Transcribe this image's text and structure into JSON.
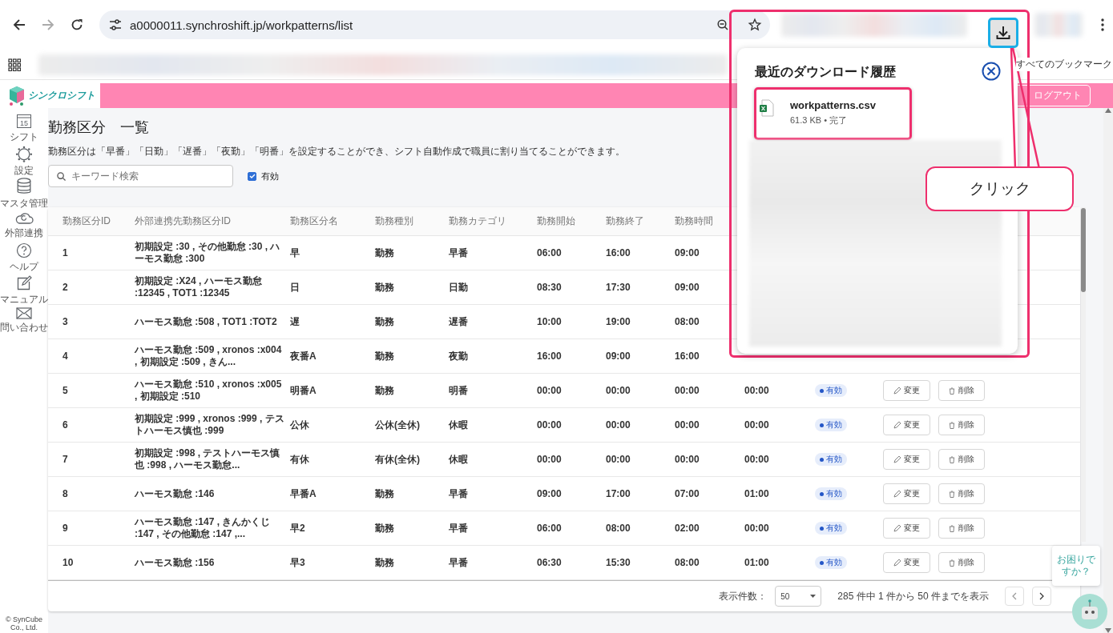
{
  "browser": {
    "url": "a0000011.synchroshift.jp/workpatterns/list",
    "bookmarks_all": "すべてのブックマーク"
  },
  "app": {
    "logo": "シンクロシフト",
    "logout": "ログアウト"
  },
  "sidebar": {
    "items": [
      {
        "kind": "calendar",
        "label": "シフト",
        "icon_text": "15"
      },
      {
        "kind": "gear",
        "label": "設定"
      },
      {
        "kind": "database",
        "label": "マスタ管理"
      },
      {
        "kind": "cloud",
        "label": "外部連携"
      },
      {
        "kind": "help",
        "label": "ヘルプ"
      },
      {
        "kind": "edit",
        "label": "マニュアル"
      },
      {
        "kind": "mail",
        "label": "問い合わせ"
      }
    ],
    "copyright": "© SynCube\nCo., Ltd."
  },
  "page": {
    "title": "勤務区分　一覧",
    "description": "勤務区分は「早番」「日勤」「遅番」「夜勤」「明番」を設定することができ、シフト自動作成で職員に割り当てることができます。"
  },
  "filter": {
    "search_placeholder": "キーワード検索",
    "active_label": "有効",
    "active_checked": true
  },
  "table": {
    "columns": [
      "勤務区分ID",
      "外部連携先勤務区分ID",
      "勤務区分名",
      "勤務種別",
      "勤務カテゴリ",
      "勤務開始",
      "勤務終了",
      "勤務時間"
    ],
    "rows": [
      {
        "id": "1",
        "external_id": "初期設定 :30 , その他勤怠 :30 , ハーモス勤怠 :300",
        "name": "早",
        "type": "勤務",
        "category": "早番",
        "start": "06:00",
        "end": "16:00",
        "hours": "09:00"
      },
      {
        "id": "2",
        "external_id": "初期設定 :X24 , ハーモス勤怠 :12345 , TOT1 :12345",
        "name": "日",
        "type": "勤務",
        "category": "日勤",
        "start": "08:30",
        "end": "17:30",
        "hours": "09:00"
      },
      {
        "id": "3",
        "external_id": "ハーモス勤怠 :508 , TOT1 :TOT2",
        "name": "遅",
        "type": "勤務",
        "category": "遅番",
        "start": "10:00",
        "end": "19:00",
        "hours": "08:00"
      },
      {
        "id": "4",
        "external_id": "ハーモス勤怠 :509 , xronos :x004 , 初期設定 :509 , きん...",
        "name": "夜番A",
        "type": "勤務",
        "category": "夜勤",
        "start": "16:00",
        "end": "09:00",
        "hours": "16:00"
      },
      {
        "id": "5",
        "external_id": "ハーモス勤怠 :510 , xronos :x005 , 初期設定 :510",
        "name": "明番A",
        "type": "勤務",
        "category": "明番",
        "start": "00:00",
        "end": "00:00",
        "hours": "00:00",
        "column_9": "00:00",
        "status": "有効",
        "edit": "変更",
        "delete": "削除"
      },
      {
        "id": "6",
        "external_id": "初期設定 :999 , xronos :999 , テストハーモス慎也 :999",
        "name": "公休",
        "type": "公休(全休)",
        "category": "休暇",
        "start": "00:00",
        "end": "00:00",
        "hours": "00:00",
        "column_9": "00:00",
        "status": "有効",
        "edit": "変更",
        "delete": "削除"
      },
      {
        "id": "7",
        "external_id": "初期設定 :998 , テストハーモス慎也 :998 , ハーモス勤怠...",
        "name": "有休",
        "type": "有休(全休)",
        "category": "休暇",
        "start": "00:00",
        "end": "00:00",
        "hours": "00:00",
        "column_9": "00:00",
        "status": "有効",
        "edit": "変更",
        "delete": "削除"
      },
      {
        "id": "8",
        "external_id": "ハーモス勤怠 :146",
        "name": "早番A",
        "type": "勤務",
        "category": "早番",
        "start": "09:00",
        "end": "17:00",
        "hours": "07:00",
        "column_9": "01:00",
        "status": "有効",
        "edit": "変更",
        "delete": "削除"
      },
      {
        "id": "9",
        "external_id": "ハーモス勤怠 :147 , きんかくじ :147 , その他勤怠 :147 ,...",
        "name": "早2",
        "type": "勤務",
        "category": "早番",
        "start": "06:00",
        "end": "08:00",
        "hours": "02:00",
        "column_9": "00:00",
        "status": "有効",
        "edit": "変更",
        "delete": "削除"
      },
      {
        "id": "10",
        "external_id": "ハーモス勤怠 :156",
        "name": "早3",
        "type": "勤務",
        "category": "早番",
        "start": "06:30",
        "end": "15:30",
        "hours": "08:00",
        "column_9": "01:00",
        "status": "有効",
        "edit": "変更",
        "delete": "削除"
      }
    ]
  },
  "pagination": {
    "page_size_label": "表示件数：",
    "page_size": "50",
    "summary": "285 件中 1 件から 50 件までを表示"
  },
  "download_popup": {
    "title": "最近のダウンロード履歴",
    "file_name": "workpatterns.csv",
    "file_info": "61.3 KB • 完了"
  },
  "callout": {
    "text": "クリック"
  },
  "chatbot": {
    "bubble": "お困りですか？"
  }
}
